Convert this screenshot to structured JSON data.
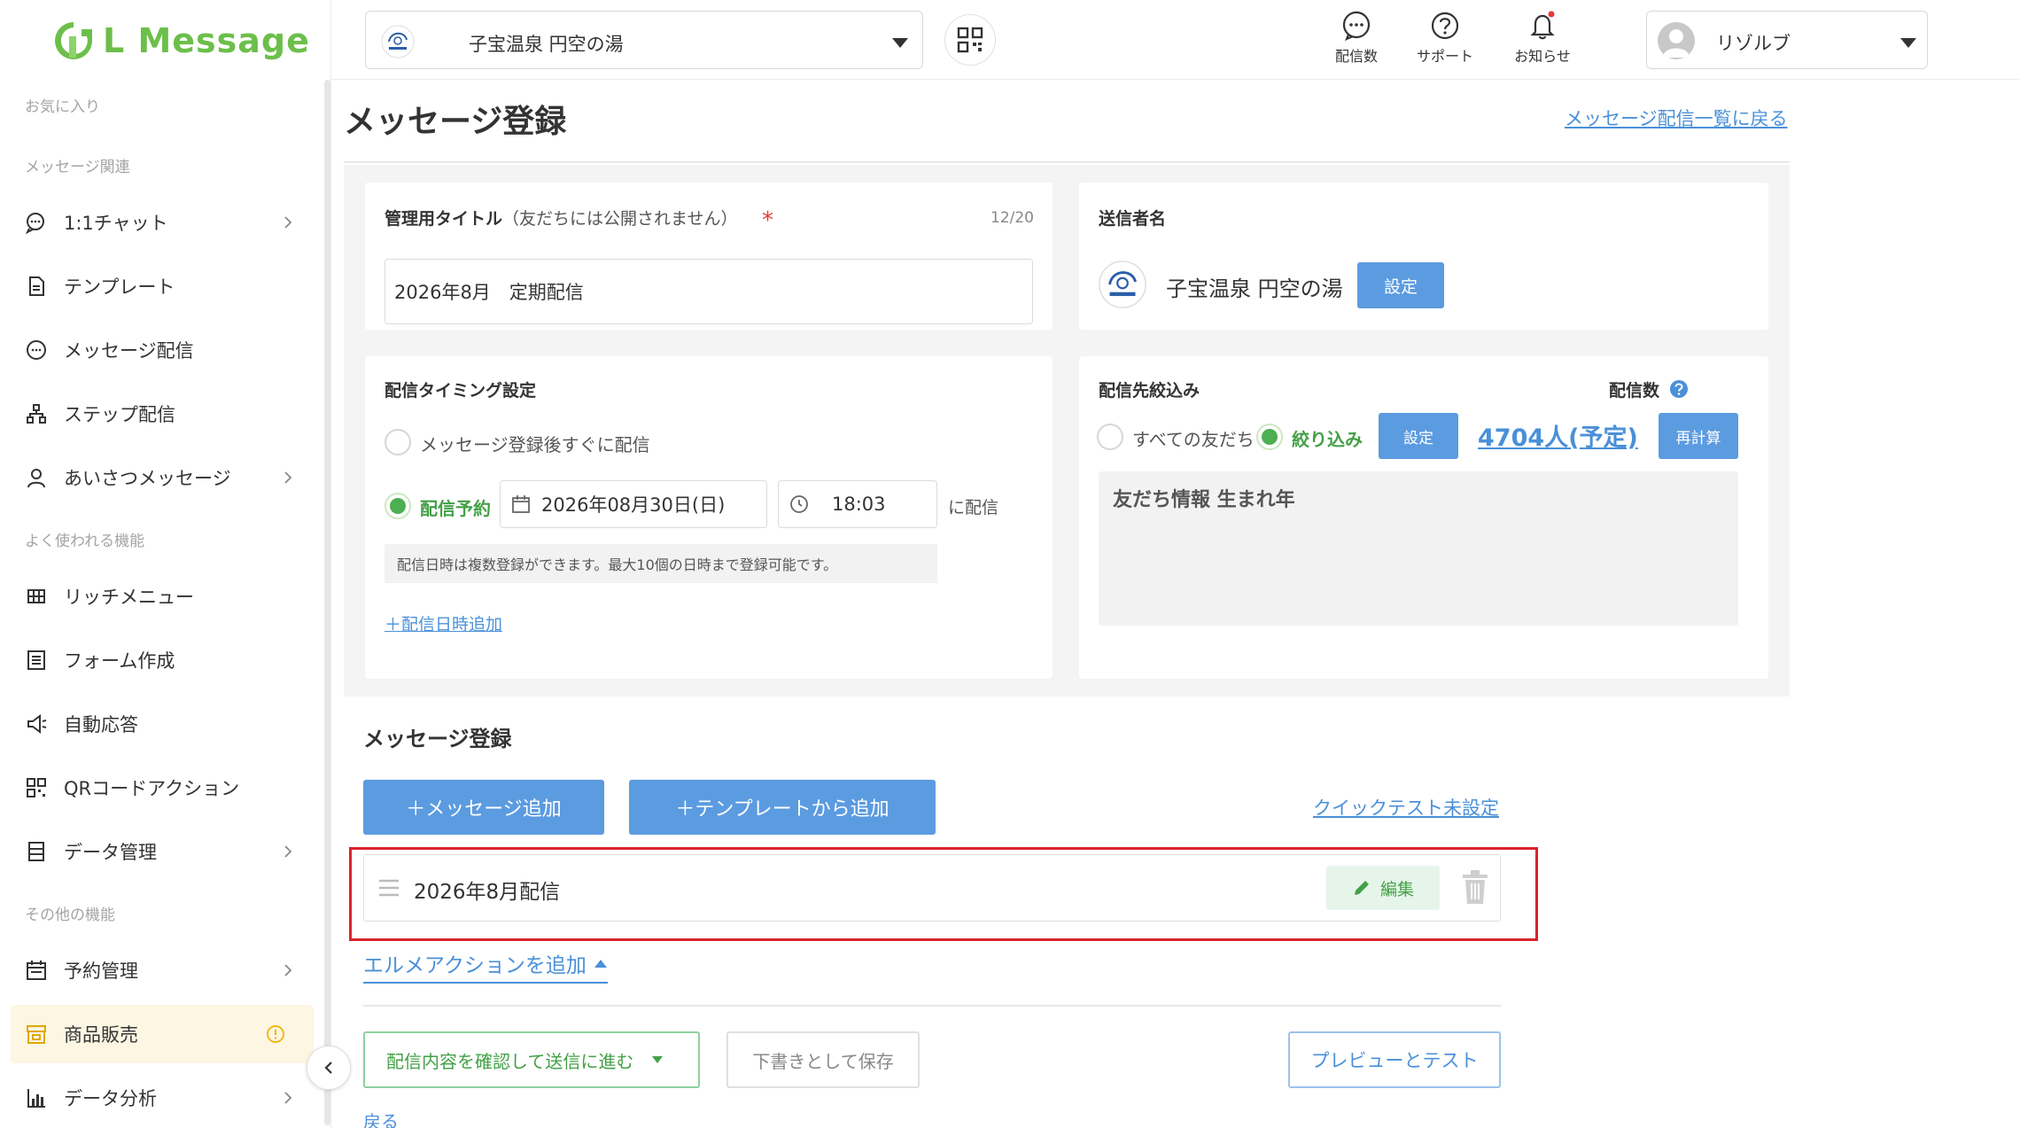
{
  "app": {
    "logo_text": "L Message"
  },
  "colors": {
    "brand_green": "#6cbf4a",
    "primary_blue": "#5b9be0",
    "link_blue": "#4a90d9",
    "success_green": "#43a047",
    "highlight_red": "#d9232d"
  },
  "sidebar": {
    "favorites_label": "お気に入り",
    "sections": [
      {
        "label": "メッセージ関連"
      },
      {
        "label": "よく使われる機能"
      },
      {
        "label": "その他の機能"
      }
    ],
    "items": [
      {
        "label": "1:1チャット",
        "icon": "chat-icon",
        "chevron": true
      },
      {
        "label": "テンプレート",
        "icon": "document-icon",
        "chevron": false
      },
      {
        "label": "メッセージ配信",
        "icon": "message-icon",
        "chevron": false
      },
      {
        "label": "ステップ配信",
        "icon": "step-icon",
        "chevron": false
      },
      {
        "label": "あいさつメッセージ",
        "icon": "person-icon",
        "chevron": true
      },
      {
        "label": "リッチメニュー",
        "icon": "grid-icon",
        "chevron": false
      },
      {
        "label": "フォーム作成",
        "icon": "form-icon",
        "chevron": false
      },
      {
        "label": "自動応答",
        "icon": "megaphone-icon",
        "chevron": false
      },
      {
        "label": "QRコードアクション",
        "icon": "qr-icon",
        "chevron": false
      },
      {
        "label": "データ管理",
        "icon": "data-icon",
        "chevron": true
      },
      {
        "label": "予約管理",
        "icon": "calendar-icon",
        "chevron": true
      },
      {
        "label": "商品販売",
        "icon": "shop-icon",
        "chevron": false,
        "active": true,
        "warning": true
      },
      {
        "label": "データ分析",
        "icon": "chart-icon",
        "chevron": true
      }
    ]
  },
  "topbar": {
    "account_name": "子宝温泉 円空の湯",
    "icons": [
      {
        "label": "配信数",
        "icon": "speech-bubble-icon"
      },
      {
        "label": "サポート",
        "icon": "help-icon"
      },
      {
        "label": "お知らせ",
        "icon": "bell-icon"
      }
    ],
    "user_name": "リゾルブ"
  },
  "page": {
    "title": "メッセージ登録",
    "back_to_list": "メッセージ配信一覧に戻る"
  },
  "admin_title": {
    "label": "管理用タイトル",
    "sublabel": "（友だちには公開されません）",
    "required_mark": "*",
    "counter": "12/20",
    "value": "2026年8月　定期配信"
  },
  "sender": {
    "label": "送信者名",
    "name": "子宝温泉 円空の湯",
    "set_button": "設定"
  },
  "timing": {
    "label": "配信タイミング設定",
    "option_immediate": "メッセージ登録後すぐに配信",
    "option_scheduled": "配信予約",
    "date": "2026年08月30日(日)",
    "time": "18:03",
    "suffix": "に配信",
    "note": "配信日時は複数登録ができます。最大10個の日時まで登録可能です。",
    "add_link": "＋配信日時追加"
  },
  "targeting": {
    "label": "配信先絞込み",
    "count_label": "配信数",
    "option_all": "すべての友だち",
    "option_filter": "絞り込み",
    "set_button": "設定",
    "count": "4704人(予定)",
    "recalc_button": "再計算",
    "filter_text": "友だち情報 生まれ年"
  },
  "messages": {
    "section_title": "メッセージ登録",
    "add_message": "＋メッセージ追加",
    "add_from_template": "＋テンプレートから追加",
    "quick_test": "クイックテスト未設定",
    "items": [
      {
        "title": "2026年8月配信",
        "edit": "編集"
      }
    ],
    "add_action": "エルメアクションを追加"
  },
  "footer": {
    "confirm_button": "配信内容を確認して送信に進む",
    "draft_button": "下書きとして保存",
    "preview_button": "プレビューとテスト",
    "back": "戻る"
  }
}
